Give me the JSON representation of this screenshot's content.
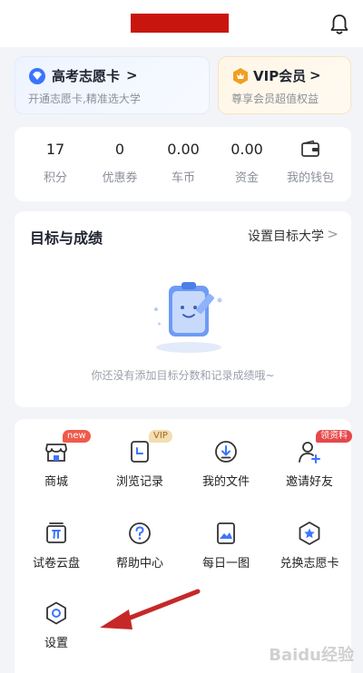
{
  "topbar": {
    "title_redacted": "",
    "bell_icon": "bell-icon"
  },
  "promos": {
    "gaokao": {
      "title": "高考志愿卡",
      "chevron": ">",
      "subtitle": "开通志愿卡,精准选大学",
      "icon": "diamond-badge-icon"
    },
    "vip": {
      "title": "VIP会员",
      "chevron": ">",
      "subtitle": "尊享会员超值权益",
      "icon": "vip-hexagon-icon"
    }
  },
  "stats": [
    {
      "value": "17",
      "label": "积分"
    },
    {
      "value": "0",
      "label": "优惠券"
    },
    {
      "value": "0.00",
      "label": "车币"
    },
    {
      "value": "0.00",
      "label": "资金"
    },
    {
      "value": "",
      "label": "我的钱包",
      "icon": "wallet-icon"
    }
  ],
  "goals": {
    "title": "目标与成绩",
    "link": "设置目标大学",
    "chevron": ">",
    "empty_text": "你还没有添加目标分数和记录成绩哦~"
  },
  "menu": [
    {
      "label": "商城",
      "icon": "shop-icon",
      "badge": "new"
    },
    {
      "label": "浏览记录",
      "icon": "history-icon",
      "badge": "VIP"
    },
    {
      "label": "我的文件",
      "icon": "download-icon",
      "badge": ""
    },
    {
      "label": "邀请好友",
      "icon": "add-user-icon",
      "badge": "领资料"
    },
    {
      "label": "试卷云盘",
      "icon": "pi-box-icon",
      "badge": ""
    },
    {
      "label": "帮助中心",
      "icon": "help-icon",
      "badge": ""
    },
    {
      "label": "每日一图",
      "icon": "picture-icon",
      "badge": ""
    },
    {
      "label": "兑换志愿卡",
      "icon": "exchange-star-icon",
      "badge": ""
    },
    {
      "label": "设置",
      "icon": "settings-icon",
      "badge": ""
    }
  ],
  "colors": {
    "accent_blue": "#3b74ff",
    "badge_red": "#f05a4b",
    "annotation_arrow": "#c62828"
  },
  "watermark": "Baidu经验"
}
